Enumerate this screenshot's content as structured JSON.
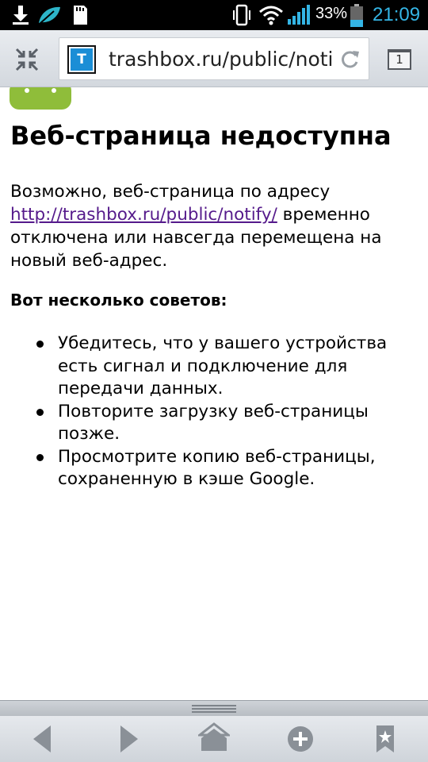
{
  "status_bar": {
    "battery_percent": "33%",
    "time": "21:09",
    "icons": [
      "download-icon",
      "leaf-icon",
      "sd-card-icon",
      "vibrate-icon",
      "wifi-icon",
      "signal-icon",
      "battery-icon"
    ]
  },
  "toolbar": {
    "url": "trashbox.ru/public/notify/",
    "favicon_letter": "T",
    "tab_count": "1",
    "icons": [
      "fullscreen-exit-icon",
      "favicon-icon",
      "reload-icon",
      "tabs-icon"
    ]
  },
  "page": {
    "title": "Веб-страница недоступна",
    "intro_before_link": "Возможно, веб-страница по адресу ",
    "link_text": "http://trashbox.ru/public/notify/",
    "intro_after_link": " временно отключена или навсегда перемещена на новый веб-адрес.",
    "tips_heading": "Вот несколько советов:",
    "tips": [
      "Убедитесь, что у вашего устройства есть сигнал и подключение для передачи данных.",
      "Повторите загрузку веб-страницы позже.",
      "Просмотрите копию веб-страницы, сохраненную в кэше Google."
    ]
  },
  "bottom_bar": {
    "icons": [
      "back-icon",
      "forward-icon",
      "home-icon",
      "add-icon",
      "bookmarks-icon"
    ]
  },
  "colors": {
    "link": "#551a8b",
    "clock": "#34b5e5",
    "favicon": "#1b8ed6",
    "android_green": "#8fbd3a"
  }
}
